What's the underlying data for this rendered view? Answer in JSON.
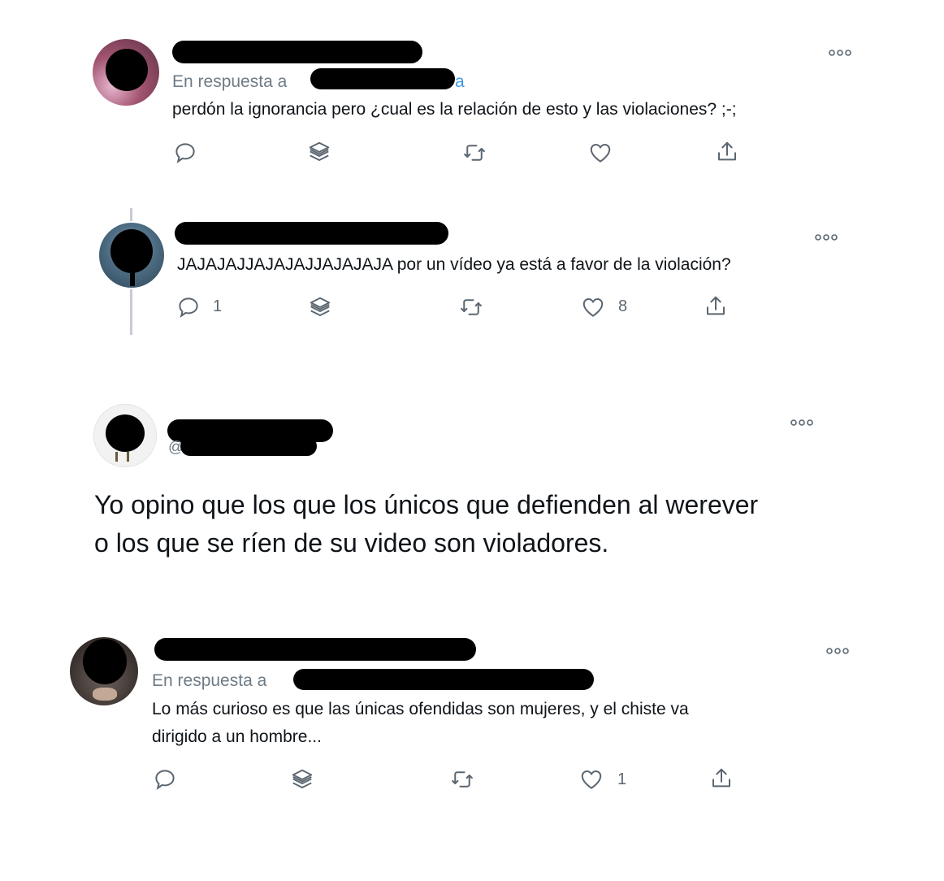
{
  "tweets": [
    {
      "reply_prefix": "En respuesta a",
      "reply_handle_tail": "a",
      "text": "perdón la ignorancia pero ¿cual es la relación de esto y las violaciones? ;-;",
      "actions": {
        "reply_count": "",
        "like_count": ""
      }
    },
    {
      "text": "JAJAJAJJAJAJAJJAJAJAJA por un vídeo ya está a favor de la violación?",
      "actions": {
        "reply_count": "1",
        "like_count": "8"
      }
    },
    {
      "handle_prefix": "@",
      "text_line1": "Yo opino que los que los únicos que defienden al werever",
      "text_line2": "o los que se ríen de su video son violadores."
    },
    {
      "reply_prefix": "En respuesta a",
      "text_line1": "Lo más curioso es que las únicas ofendidas son mujeres, y el chiste va",
      "text_line2": "dirigido a un hombre...",
      "actions": {
        "reply_count": "",
        "like_count": "1"
      }
    }
  ],
  "icons": {
    "reply": "reply-icon",
    "stack": "stack-icon",
    "retweet": "retweet-icon",
    "like": "heart-icon",
    "share": "share-icon",
    "more": "more-options-icon"
  },
  "colors": {
    "muted": "#6e7b86",
    "link": "#3f9ae8",
    "icon": "#5b6670"
  }
}
